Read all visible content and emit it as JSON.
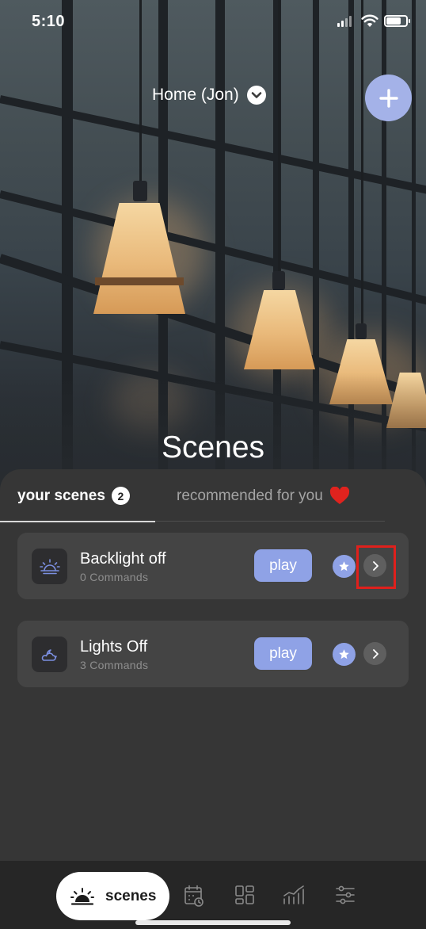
{
  "status_bar": {
    "time": "5:10"
  },
  "header": {
    "home_label": "Home (Jon)"
  },
  "page_title": "Scenes",
  "tabs": [
    {
      "label": "your scenes",
      "count": "2",
      "active": true
    },
    {
      "label": "recommended for you",
      "active": false
    }
  ],
  "scenes": [
    {
      "name": "Backlight off",
      "commands": "0 Commands",
      "icon": "sunrise-icon",
      "play_label": "play",
      "highlighted": true
    },
    {
      "name": "Lights Off",
      "commands": "3 Commands",
      "icon": "moon-cloud-icon",
      "play_label": "play",
      "highlighted": false
    }
  ],
  "bottom_nav": {
    "active_label": "scenes",
    "items": [
      "scenes-icon",
      "schedule-icon",
      "dashboard-icon",
      "stats-icon",
      "settings-icon"
    ]
  },
  "colors": {
    "accent": "#8fa2e6",
    "add_button": "#a4b2e8",
    "panel": "#363636",
    "card": "#444444",
    "heart": "#e0231e",
    "highlight_box": "#e0201c"
  }
}
